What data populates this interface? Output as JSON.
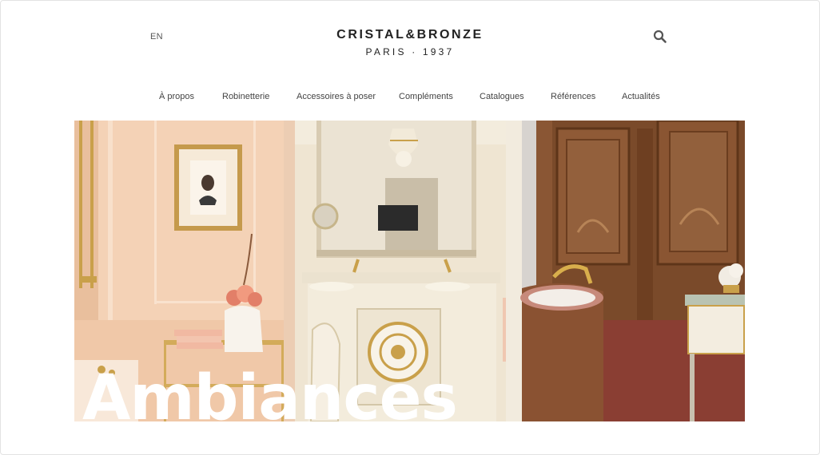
{
  "header": {
    "language": "EN",
    "brand_name": "CRISTAL&BRONZE",
    "brand_tagline": "PARIS · 1937",
    "search_icon": "search-icon"
  },
  "nav": {
    "items": [
      {
        "label": "À propos"
      },
      {
        "label": "Robinetterie"
      },
      {
        "label": "Accessoires à poser"
      },
      {
        "label": "Compléments"
      },
      {
        "label": "Catalogues"
      },
      {
        "label": "Références"
      },
      {
        "label": "Actualités"
      }
    ]
  },
  "hero": {
    "title": "Ambiances",
    "panels": [
      "peach-bathroom-vanity",
      "cream-vanity-with-mirror",
      "wood-paneled-bath"
    ]
  },
  "colors": {
    "text": "#333333",
    "hero_title": "#ffffff",
    "peach": "#f3cfb2",
    "cream": "#efe6d3",
    "wood": "#7a4a2a"
  }
}
